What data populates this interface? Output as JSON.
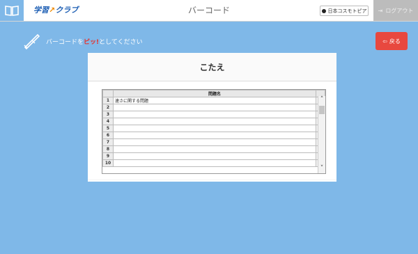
{
  "header": {
    "logo_main": "学習",
    "logo_sub": "クラブ",
    "title": "バーコード",
    "org_label": "日本コスモトピア",
    "logout_label": "ログアウト"
  },
  "instruction": {
    "prefix": "バーコードを",
    "emphasis": "ピッ!",
    "suffix": "としてください"
  },
  "back_button": {
    "label": "戻る"
  },
  "panel": {
    "title": "こたえ",
    "column_header": "問題名",
    "rows": [
      {
        "num": "1",
        "text": "速さに関する問題"
      },
      {
        "num": "2",
        "text": ""
      },
      {
        "num": "3",
        "text": ""
      },
      {
        "num": "4",
        "text": ""
      },
      {
        "num": "5",
        "text": ""
      },
      {
        "num": "6",
        "text": ""
      },
      {
        "num": "7",
        "text": ""
      },
      {
        "num": "8",
        "text": ""
      },
      {
        "num": "9",
        "text": ""
      },
      {
        "num": "10",
        "text": ""
      }
    ]
  },
  "colors": {
    "background": "#7fb8e8",
    "back_button": "#e8483f",
    "emphasis": "#e8312a",
    "logout": "#bcbcbc"
  }
}
